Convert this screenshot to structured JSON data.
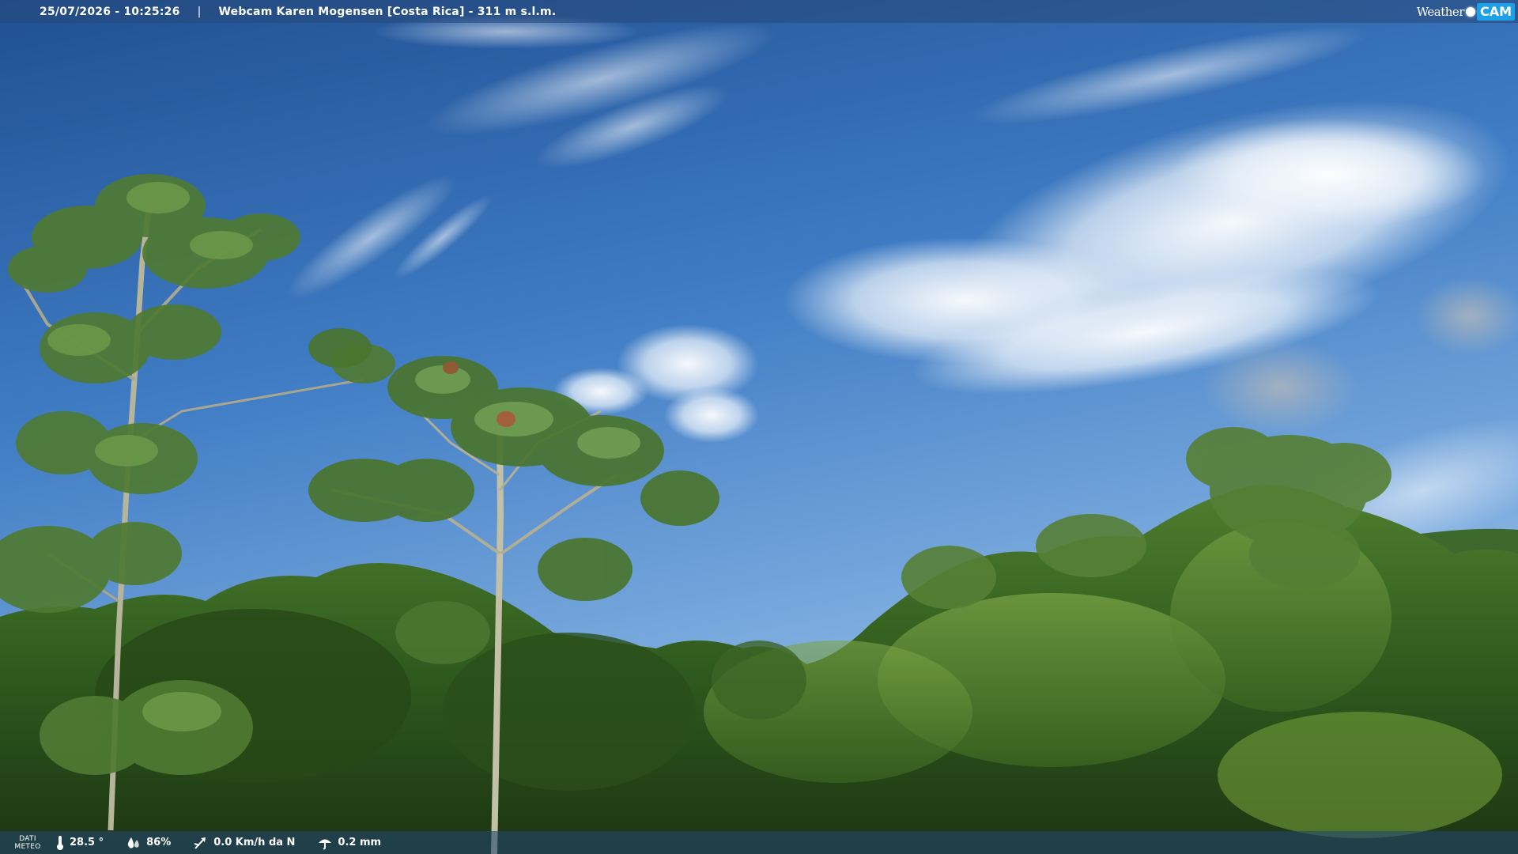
{
  "header": {
    "datetime": "25/07/2026 - 10:25:26",
    "separator": "|",
    "title": "Webcam Karen Mogensen [Costa Rica] - 311 m s.l.m.",
    "logo_weather": "Weather",
    "logo_cam": "CAM"
  },
  "weather_bar": {
    "label_line1": "DATI",
    "label_line2": "METEO",
    "temperature": "28.5 °",
    "humidity": "86%",
    "wind": "0.0 Km/h da N",
    "rain": "0.2 mm",
    "icons": {
      "temperature": "thermometer-icon",
      "humidity": "humidity-drops-icon",
      "wind": "wind-vane-icon",
      "rain": "umbrella-icon"
    }
  },
  "colors": {
    "sky_top": "#1f4f93",
    "sky_mid": "#3f7cc4",
    "sky_low": "#7faee0",
    "forest_dark": "#1f3d17",
    "forest_mid": "#3f6f28",
    "forest_light": "#6f9a3e",
    "logo_cam_bg": "#1ea0e6"
  }
}
